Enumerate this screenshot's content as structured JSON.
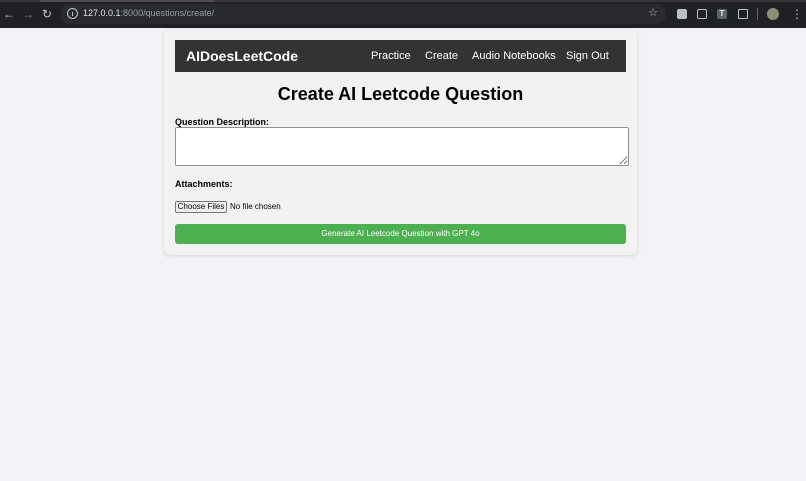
{
  "browser": {
    "url_host": "127.0.0.1",
    "url_path": ":8000/questions/create/",
    "extension_t_label": "T"
  },
  "navbar": {
    "brand": "AIDoesLeetCode",
    "links": [
      {
        "label": "Practice"
      },
      {
        "label": "Create"
      },
      {
        "label": "Audio Notebooks"
      },
      {
        "label": "Sign Out"
      }
    ]
  },
  "form": {
    "title": "Create AI Leetcode Question",
    "description_label": "Question Description:",
    "description_value": "",
    "attachments_label": "Attachments:",
    "choose_files_label": "Choose Files",
    "file_status": "No file chosen",
    "submit_label": "Generate AI Leetcode Question with GPT 4o"
  },
  "colors": {
    "navbar_bg": "#333333",
    "submit_bg": "#4caf50",
    "page_bg": "#f3f2f7",
    "browser_bg": "#202124"
  },
  "icons": [
    "back-arrow-icon",
    "forward-arrow-icon",
    "reload-icon",
    "site-info-icon",
    "bookmark-star-icon",
    "extension-icon",
    "puzzle-extensions-icon",
    "profile-avatar-icon",
    "menu-kebab-icon"
  ]
}
